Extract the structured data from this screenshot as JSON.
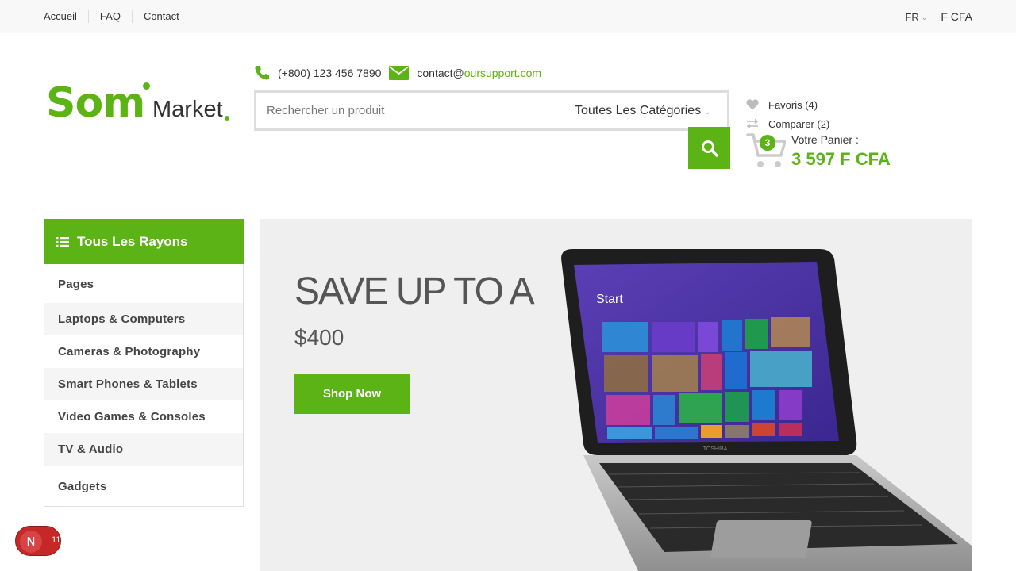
{
  "topbar": {
    "nav": [
      "Accueil",
      "FAQ",
      "Contact"
    ],
    "language": "FR",
    "currency": "F CFA"
  },
  "header": {
    "logo_primary": "Som",
    "logo_secondary": "Market",
    "phone": "(+800) 123 456 7890",
    "email_prefix": "contact@",
    "email_domain": "oursupport.com",
    "search_placeholder": "Rechercher un produit",
    "category_select": "Toutes Les Catégories",
    "favorites": "Favoris (4)",
    "compare": "Comparer (2)",
    "cart_count": "3",
    "cart_label": "Votre Panier :",
    "cart_total": "3 597 F CFA"
  },
  "sidebar": {
    "title": "Tous Les Rayons",
    "items": [
      "Pages",
      "Laptops & Computers",
      "Cameras & Photography",
      "Smart Phones & Tablets",
      "Video Games & Consoles",
      "TV & Audio",
      "Gadgets"
    ]
  },
  "banner": {
    "headline": "SAVE UP TO A",
    "price": "$400",
    "cta": "Shop Now",
    "screen_label": "Start",
    "laptop_brand": "TOSHIBA"
  },
  "floating_badge": {
    "letter": "N",
    "count": "11"
  },
  "colors": {
    "accent": "#5cb315",
    "badge": "#c62828"
  },
  "icons": [
    "phone-icon",
    "mail-icon",
    "search-icon",
    "heart-icon",
    "compare-icon",
    "cart-icon",
    "list-icon",
    "chevron-down-icon"
  ]
}
